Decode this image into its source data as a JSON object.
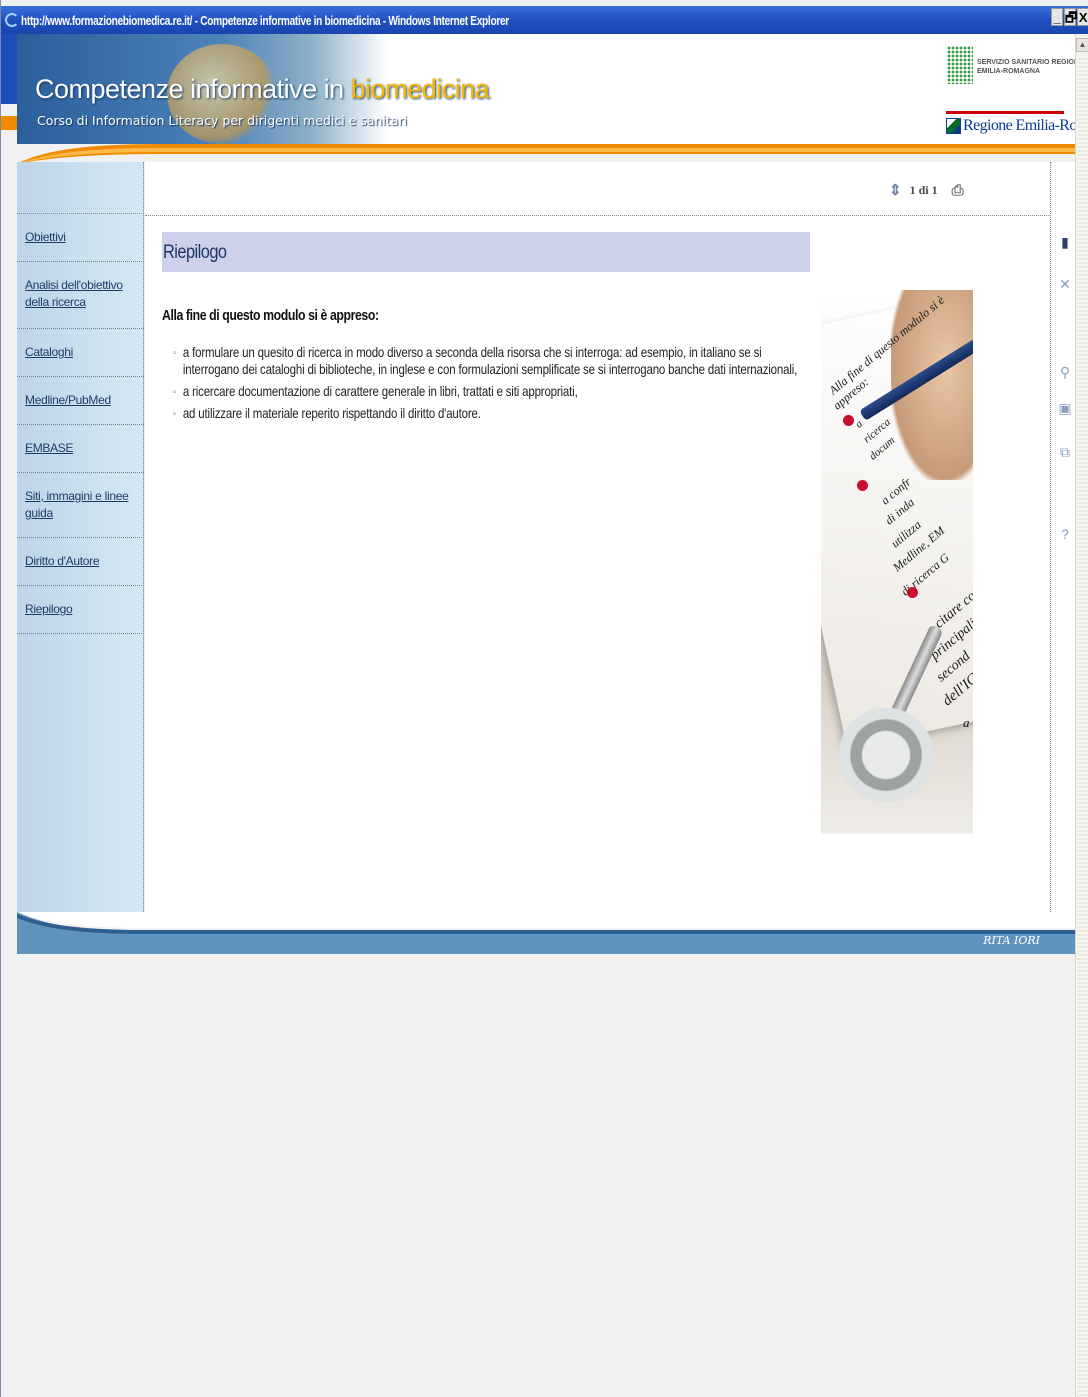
{
  "window": {
    "title": "http://www.formazionebiomedica.re.it/ - Competenze informative in biomedicina - Windows Internet Explorer",
    "buttons": [
      "_",
      "🗗",
      "X"
    ]
  },
  "header": {
    "title_main": "Competenze informative in ",
    "title_highlight": "biomedicina",
    "subtitle": "Corso di Information Literacy per dirigenti medici e sanitari",
    "ssr_line1": "SERVIZIO SANITARIO REGIONALE",
    "ssr_line2": "EMILIA-ROMAGNA",
    "region": "Regione Emilia-Romagna"
  },
  "sidebar": {
    "items": [
      {
        "label": "Obiettivi"
      },
      {
        "label": "Analisi dell'obiettivo della ricerca"
      },
      {
        "label": "Cataloghi"
      },
      {
        "label": "Medline/PubMed"
      },
      {
        "label": "EMBASE"
      },
      {
        "label": "Siti, immagini e linee guida"
      },
      {
        "label": "Diritto d'Autore"
      },
      {
        "label": "Riepilogo"
      }
    ]
  },
  "toolbar": {
    "pager": "1 di 1"
  },
  "main": {
    "section_title": "Riepilogo",
    "lead": "Alla fine di questo modulo si è appreso:",
    "bullets": [
      "a formulare un quesito di ricerca in modo diverso a seconda della risorsa che si interroga: ad esempio, in italiano se si interrogano dei cataloghi di biblioteche, in inglese e con formulazioni semplificate se si interrogano banche dati internazionali,",
      "a ricercare documentazione di carattere generale in libri, trattati e siti appropriati,",
      "ad utilizzare il materiale reperito rispettando il diritto d'autore."
    ]
  },
  "illustration": {
    "line1": "Alla fine di questo modulo si è",
    "line2": "appreso:",
    "fragments": [
      "a",
      "ricerca",
      "docum",
      "a confr",
      "di inda",
      "utilizza",
      "Medline, EM",
      "di ricerca G",
      "a citare cor",
      "principali",
      "second",
      "dell'IC",
      "a"
    ]
  },
  "footer": {
    "author": "RITA IORI"
  },
  "colors": {
    "title_bar": "#1f4fbf",
    "header_accent": "#f6b800",
    "sidebar_bg": "#bcd5e8",
    "section_bar": "#cdd1ea",
    "footer": "#5f93bd",
    "orange": "#f08a00"
  },
  "icons": {
    "pager": "refresh-arrow-icon",
    "print": "printer-icon",
    "rail": [
      "bookmark-icon",
      "close-icon",
      "search-icon",
      "image-icon",
      "copy-icon",
      "help-icon"
    ]
  }
}
